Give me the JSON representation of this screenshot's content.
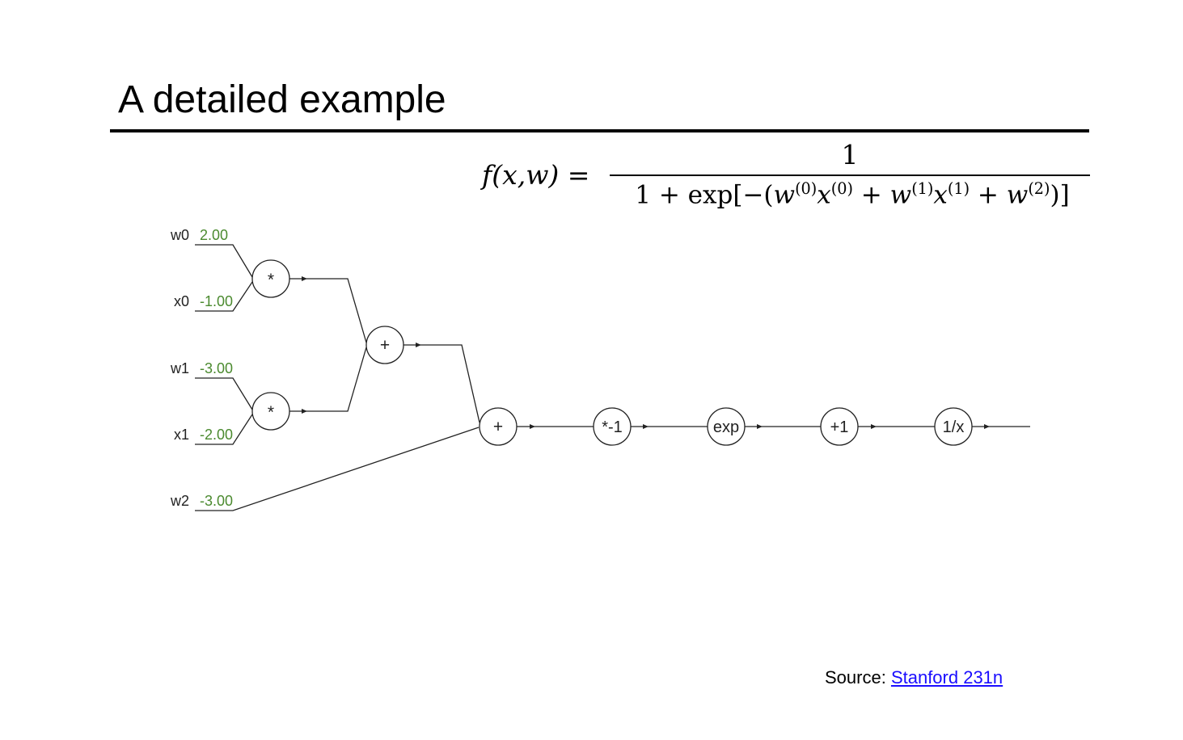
{
  "slide": {
    "title": "A detailed example"
  },
  "formula": {
    "lhs": "f(x,w) =",
    "numerator": "1",
    "denominator": {
      "prefix": "1 + exp[−(",
      "w0": "w",
      "w0_sup": "(0)",
      "x0": "x",
      "x0_sup": "(0)",
      "plus1": " + ",
      "w1": "w",
      "w1_sup": "(1)",
      "x1": "x",
      "x1_sup": "(1)",
      "plus2": " + ",
      "w2": "w",
      "w2_sup": "(2)",
      "suffix": ")]"
    }
  },
  "graph": {
    "inputs": [
      {
        "name": "w0",
        "value": "2.00"
      },
      {
        "name": "x0",
        "value": "-1.00"
      },
      {
        "name": "w1",
        "value": "-3.00"
      },
      {
        "name": "x1",
        "value": "-2.00"
      },
      {
        "name": "w2",
        "value": "-3.00"
      }
    ],
    "nodes": [
      {
        "id": "mul0",
        "label": "*"
      },
      {
        "id": "mul1",
        "label": "*"
      },
      {
        "id": "add0",
        "label": "+"
      },
      {
        "id": "add1",
        "label": "+"
      },
      {
        "id": "neg",
        "label": "*-1"
      },
      {
        "id": "exp",
        "label": "exp"
      },
      {
        "id": "plus1",
        "label": "+1"
      },
      {
        "id": "recip",
        "label": "1/x"
      }
    ],
    "colors": {
      "value": "#4b8a2f",
      "wire": "#222222"
    }
  },
  "source": {
    "label": "Source: ",
    "link_text": "Stanford 231n",
    "link_color": "#1a0dff"
  }
}
